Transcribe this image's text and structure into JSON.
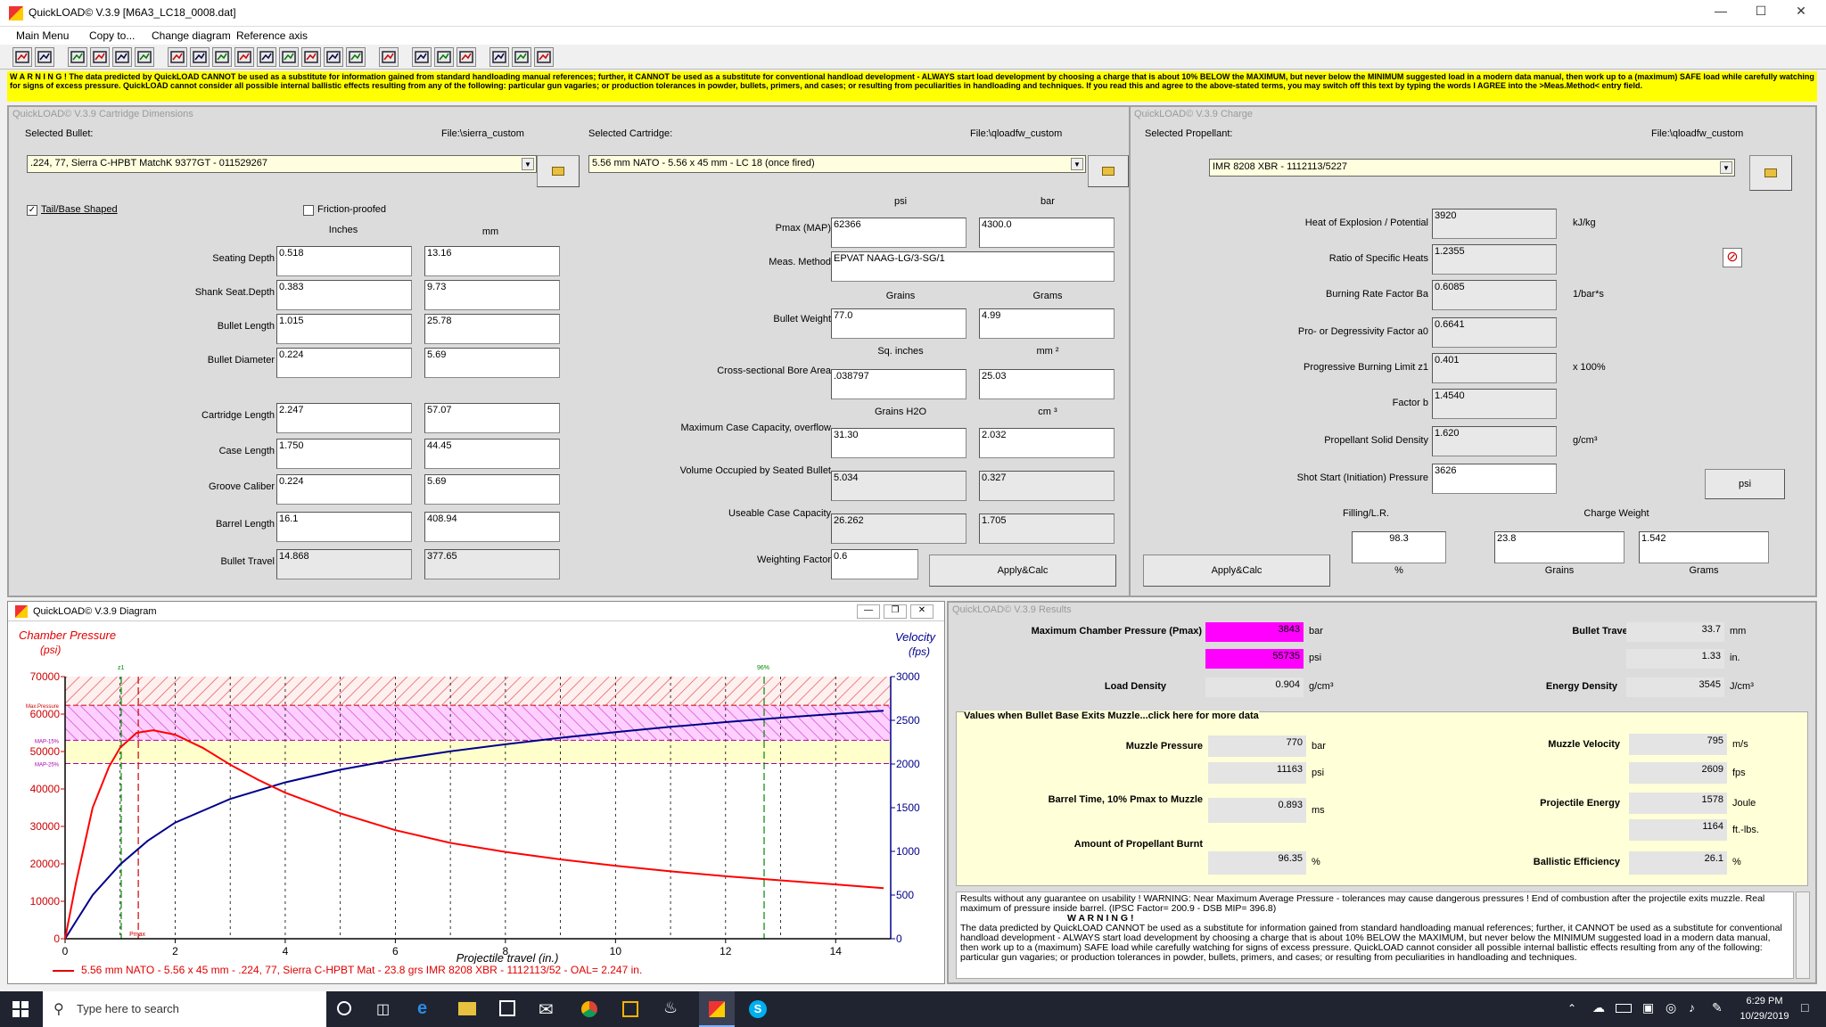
{
  "window": {
    "title": "QuickLOAD© V.3.9   [M6A3_LC18_0008.dat]"
  },
  "menu": [
    "Main Menu",
    "Copy to...",
    "Change diagram",
    "Reference axis"
  ],
  "warning": "W A R N I N G ! The data predicted by QuickLOAD CANNOT be used as a substitute for information gained from standard handloading manual references; further, it CANNOT be used as a substitute for conventional handload development - ALWAYS start load development by choosing a charge that is about 10% BELOW the MAXIMUM, but never below the MINIMUM suggested load in a modern data manual, then work up to a (maximum) SAFE load while carefully watching for signs of excess pressure. QuickLOAD cannot consider all possible internal ballistic effects resulting from any of the following: particular gun vagaries; or production tolerances in powder, bullets, primers, and cases; or resulting from peculiarities in handloading and techniques. If you read this and agree to the above-stated terms, you may switch off this text by typing the words I AGREE into the >Meas.Method< entry field.",
  "dims": {
    "title": "QuickLOAD© V.3.9 Cartridge Dimensions",
    "sel_bullet_label": "Selected Bullet:",
    "bullet_file": "File:\\sierra_custom",
    "bullet": ".224, 77, Sierra C-HPBT MatchK 9377GT - 011529267",
    "sel_cart_label": "Selected Cartridge:",
    "cart_file": "File:\\qloadfw_custom",
    "cartridge": "5.56 mm NATO - 5.56 x 45 mm - LC 18 (once fired)",
    "tail_label": "Tail/Base Shaped",
    "friction_label": "Friction-proofed",
    "col_in": "Inches",
    "col_mm": "mm",
    "rows": [
      {
        "label": "Seating Depth",
        "in": "0.518",
        "mm": "13.16"
      },
      {
        "label": "Shank Seat.Depth",
        "in": "0.383",
        "mm": "9.73"
      },
      {
        "label": "Bullet Length",
        "in": "1.015",
        "mm": "25.78"
      },
      {
        "label": "Bullet Diameter",
        "in": "0.224",
        "mm": "5.69"
      },
      {
        "label": "Cartridge Length",
        "in": "2.247",
        "mm": "57.07"
      },
      {
        "label": "Case Length",
        "in": "1.750",
        "mm": "44.45"
      },
      {
        "label": "Groove Caliber",
        "in": "0.224",
        "mm": "5.69"
      },
      {
        "label": "Barrel Length",
        "in": "16.1",
        "mm": "408.94"
      },
      {
        "label": "Bullet Travel",
        "in": "14.868",
        "mm": "377.65"
      }
    ],
    "psi": "psi",
    "bar": "bar",
    "pmax_label": "Pmax (MAP)",
    "pmax_psi": "62366",
    "pmax_bar": "4300.0",
    "meas_label": "Meas. Method",
    "meas": "EPVAT NAAG-LG/3-SG/1",
    "grains": "Grains",
    "grams": "Grams",
    "bw_label": "Bullet Weight",
    "bw_gr": "77.0",
    "bw_g": "4.99",
    "sqin": "Sq. inches",
    "mm2": "mm ²",
    "bore_label": "Cross-sectional Bore Area",
    "bore_in": ".038797",
    "bore_mm": "25.03",
    "gh2o": "Grains H2O",
    "cm3": "cm ³",
    "cap_label": "Maximum Case Capacity, overflow",
    "cap_gr": "31.30",
    "cap_cm": "2.032",
    "vol_label": "Volume Occupied by Seated Bullet",
    "vol_gr": "5.034",
    "vol_cm": "0.327",
    "use_label": "Useable Case Capacity",
    "use_gr": "26.262",
    "use_cm": "1.705",
    "wf_label": "Weighting Factor",
    "wf": "0.6",
    "apply": "Apply&Calc"
  },
  "charge": {
    "title": "QuickLOAD© V.3.9 Charge",
    "sel_label": "Selected Propellant:",
    "file": "File:\\qloadfw_custom",
    "propellant": "IMR 8208 XBR - 1112113/5227",
    "rows": [
      {
        "label": "Heat of Explosion / Potential",
        "val": "3920",
        "unit": "kJ/kg"
      },
      {
        "label": "Ratio of Specific Heats",
        "val": "1.2355",
        "unit": ""
      },
      {
        "label": "Burning Rate Factor  Ba",
        "val": "0.6085",
        "unit": "1/bar*s"
      },
      {
        "label": "Pro- or Degressivity Factor  a0",
        "val": "0.6641",
        "unit": ""
      },
      {
        "label": "Progressive Burning Limit z1",
        "val": "0.401",
        "unit": "x 100%"
      },
      {
        "label": "Factor  b",
        "val": "1.4540",
        "unit": ""
      },
      {
        "label": "Propellant Solid Density",
        "val": "1.620",
        "unit": "g/cm³"
      },
      {
        "label": "Shot Start (Initiation) Pressure",
        "val": "3626",
        "unit": ""
      }
    ],
    "psi_btn": "psi",
    "filling_label": "Filling/L.R.",
    "charge_label": "Charge Weight",
    "filling": "98.3",
    "charge_gr": "23.8",
    "charge_g": "1.542",
    "pct": "%",
    "grains": "Grains",
    "grams": "Grams",
    "apply": "Apply&Calc"
  },
  "diagram": {
    "title": "QuickLOAD© V.3.9 Diagram",
    "legend": "5.56 mm NATO - 5.56 x 45 mm - .224, 77, Sierra C-HPBT Mat - 23.8 grs IMR 8208 XBR - 1112113/52 - OAL= 2.247 in.",
    "chart_data": {
      "type": "line",
      "ylabel": "Chamber Pressure",
      "yunit": "(psi)",
      "y2label": "Velocity",
      "y2unit": "(fps)",
      "xlabel": "Projectile travel (in.)",
      "xlim": [
        0,
        15
      ],
      "ylim": [
        0,
        70000
      ],
      "y2lim": [
        0,
        3000
      ],
      "xticks": [
        "0",
        "2",
        "4",
        "6",
        "8",
        "10",
        "12",
        "14"
      ],
      "yticks": [
        "0",
        "10000",
        "20000",
        "30000",
        "40000",
        "50000",
        "60000",
        "70000"
      ],
      "y2ticks": [
        "0",
        "500",
        "1000",
        "1500",
        "2000",
        "2500",
        "3000"
      ],
      "marks": {
        "z1": "z1",
        "pmax": "Pmax",
        "p96": "96%",
        "maxp": "Max.Pressure",
        "map15": "MAP-15%",
        "map25": "MAP-25%"
      },
      "pressure": {
        "x": [
          0,
          0.2,
          0.5,
          0.8,
          1.0,
          1.3,
          1.6,
          2.0,
          2.5,
          3.0,
          3.5,
          4.0,
          5.0,
          6.0,
          7.0,
          8.0,
          9.0,
          10.0,
          11.0,
          12.0,
          13.0,
          14.0,
          14.87
        ],
        "y": [
          0,
          15000,
          35000,
          46000,
          51000,
          55000,
          55700,
          54500,
          51000,
          46500,
          42500,
          39000,
          33500,
          29000,
          25600,
          23200,
          21200,
          19500,
          18000,
          16700,
          15600,
          14500,
          13500
        ]
      },
      "velocity": {
        "x": [
          0,
          0.2,
          0.5,
          1.0,
          1.5,
          2.0,
          3.0,
          4.0,
          5.0,
          6.0,
          7.0,
          8.0,
          9.0,
          10.0,
          11.0,
          12.0,
          13.0,
          14.0,
          14.87
        ],
        "y": [
          0,
          200,
          500,
          850,
          1120,
          1330,
          1600,
          1790,
          1935,
          2050,
          2145,
          2225,
          2300,
          2365,
          2425,
          2480,
          2530,
          2575,
          2609
        ]
      }
    }
  },
  "results": {
    "title": "QuickLOAD© V.3.9 Results",
    "mcp_label": "Maximum Chamber Pressure (Pmax)",
    "mcp_bar": "3843",
    "mcp_psi": "55735",
    "u_bar": "bar",
    "u_psi": "psi",
    "bt_label": "Bullet Travel at Pmax",
    "bt_mm": "33.7",
    "bt_in": "1.33",
    "u_mm": "mm",
    "u_in": "in.",
    "ld_label": "Load Density",
    "ld": "0.904",
    "u_gcm": "g/cm³",
    "ed_label": "Energy Density",
    "ed": "3545",
    "u_jcm": "J/cm³",
    "muzzle_title": "Values when Bullet Base Exits Muzzle...click here for more data",
    "mp_label": "Muzzle Pressure",
    "mp_bar": "770",
    "mp_psi": "11163",
    "mv_label": "Muzzle Velocity",
    "mv_ms": "795",
    "mv_fps": "2609",
    "u_ms": "m/s",
    "u_fps": "fps",
    "bt2_label": "Barrel Time, 10% Pmax to Muzzle",
    "bt2": "0.893",
    "u_ms2": "ms",
    "pe_label": "Projectile Energy",
    "pe_j": "1578",
    "pe_ft": "1164",
    "u_j": "Joule",
    "u_ft": "ft.-lbs.",
    "ap_label": "Amount of Propellant Burnt",
    "ap": "96.35",
    "u_pct": "%",
    "be_label": "Ballistic Efficiency",
    "be": "26.1",
    "note1": "Results without any guarantee on usability !  WARNING: Near Maximum Average Pressure - tolerances may cause dangerous pressures !  End of combustion after the projectile exits muzzle.  Real maximum of pressure inside barrel.  (IPSC Factor= 200.9 - DSB MIP= 396.8)",
    "note2": "W A R N I N G !",
    "note3": "The data predicted by QuickLOAD CANNOT be used as a substitute for information gained from standard handloading manual references; further, it CANNOT be used as a substitute for conventional handload development - ALWAYS start load development by choosing a charge that is about 10% BELOW the MAXIMUM, but never below the MINIMUM suggested load in a modern data manual, then work up to a (maximum) SAFE load while carefully watching for signs of excess pressure. QuickLOAD cannot consider all possible internal ballistic effects resulting from any of the following: particular gun vagaries; or production tolerances in powder, bullets, primers, and cases; or resulting from peculiarities in handloading and techniques."
  },
  "taskbar": {
    "search": "Type here to search",
    "time": "6:29 PM",
    "date": "10/29/2019"
  }
}
